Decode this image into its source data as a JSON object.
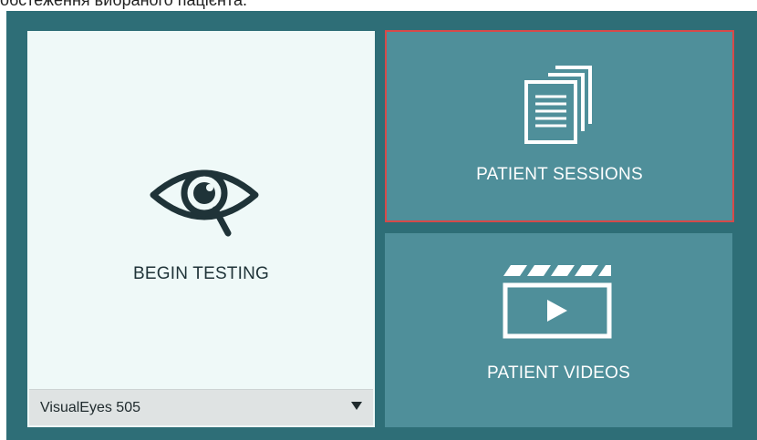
{
  "caption": "обстеження вибраного пацієнта.",
  "begin": {
    "label": "BEGIN TESTING",
    "icon": "eye-magnifier-icon",
    "device_select": {
      "value": "VisualEyes 505",
      "icon": "caret-down-icon"
    }
  },
  "sessions": {
    "label": "PATIENT SESSIONS",
    "icon": "documents-icon",
    "selected": true
  },
  "videos": {
    "label": "PATIENT VIDEOS",
    "icon": "clapperboard-play-icon"
  },
  "colors": {
    "frame": "#2e6e77",
    "tile": "#4f8f9a",
    "begin_tile": "#eff9f8",
    "selection_border": "#d64a4a"
  }
}
